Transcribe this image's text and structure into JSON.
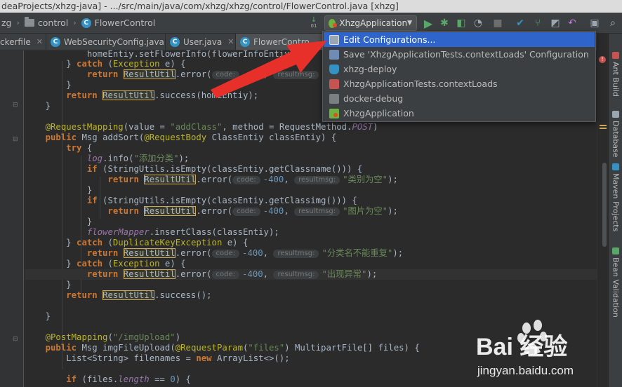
{
  "window": {
    "title": "deaProjects/xhzg-java] - .../src/main/java/com/xhzg/xhzg/control/FlowerControl.java [xhzg]"
  },
  "breadcrumb": {
    "items": [
      "zg",
      "control",
      "FlowerControl"
    ]
  },
  "run_config": {
    "selected": "XhzgApplication"
  },
  "tabs": [
    {
      "label": "ckerfile"
    },
    {
      "label": "WebSecurityConfig.java"
    },
    {
      "label": "User.java"
    },
    {
      "label": "FlowerContro"
    }
  ],
  "dropdown": {
    "items": [
      {
        "label": "Edit Configurations...",
        "icon": "edit-config-icon"
      },
      {
        "label": "Save 'XhzgApplicationTests.contextLoads' Configuration",
        "icon": "save-icon"
      },
      {
        "label": "xhzg-deploy",
        "icon": "docker-icon"
      },
      {
        "label": "XhzgApplicationTests.contextLoads",
        "icon": "junit-icon"
      },
      {
        "label": "docker-debug",
        "icon": "docker-icon"
      },
      {
        "label": "XhzgApplication",
        "icon": "spring-boot-icon"
      }
    ]
  },
  "side_tools": [
    "Ant Build",
    "Database",
    "Maven Projects",
    "Bean Validation"
  ],
  "code": {
    "l0": "homeEntiy.setFlowerInfo(flowerInfoEntiys);",
    "l1_kw": "catch",
    "l1_cls": "Exception",
    "l1_rest": " e) {",
    "return_kw": "return",
    "ru": "ResultUtil",
    "error": ".error(",
    "hint_code": "code:",
    "minus400": "-400",
    "hint_msg": "resultmsg:",
    "str_chuxian": "\"出现异常\"",
    "success_home": ".success(homeEntiy);",
    "annotation_rm": "@RequestMapping",
    "rm_args1": "(value = ",
    "str_addclass": "\"addClass\"",
    "rm_args2": ", method = ",
    "rm_method": "RequestMethod.",
    "rm_post": "POST",
    "public_kw": "public",
    "msg": "Msg",
    "addsort": " addSort(",
    "requestbody": "@RequestBody",
    "classentiy": "ClassEntiy",
    "classentiy_var": " classEntiy) {",
    "try_kw": "try",
    "log": "log",
    "info": ".info(",
    "str_add": "\"添加分类\"",
    "if_kw": "if",
    "stringutils": "StringUtils",
    "isempty_name": ".isEmpty(classEntiy.getClassname())) {",
    "str_name_empty": "\"类别为空\"",
    "isempty_img": ".isEmpty(classEntiy.getClassimg())) {",
    "str_img_empty": "\"图片为空\"",
    "flowermapper": "flowerMapper",
    "insertclass": ".insertClass(classEntiy);",
    "dup_exc": "DuplicateKeyException",
    "str_dup": "\"分类名不能重复\"",
    "exception": "Exception",
    "success_empty": ".success();",
    "annotation_pm": "@PostMapping",
    "str_imgupload": "\"/imgUpload\"",
    "imgfileupload": " imgFileUpload(",
    "requestparam": "@RequestParam",
    "str_files": "\"files\"",
    "multipart": " MultipartFile",
    "files_rest": "[] files) {",
    "list_str": "List<String>",
    "filenames": " filenames = ",
    "new_kw": "new",
    "arraylist": " ArrayList<>();",
    "if_files": " (files.",
    "length": "length",
    "eq_zero": " == ",
    "zero": "0",
    "close_brace": ") {",
    "semicolon_paren": ");",
    "comma": ", "
  },
  "watermark": {
    "text": "Bai 经验",
    "url": "jingyan.baidu.com"
  }
}
